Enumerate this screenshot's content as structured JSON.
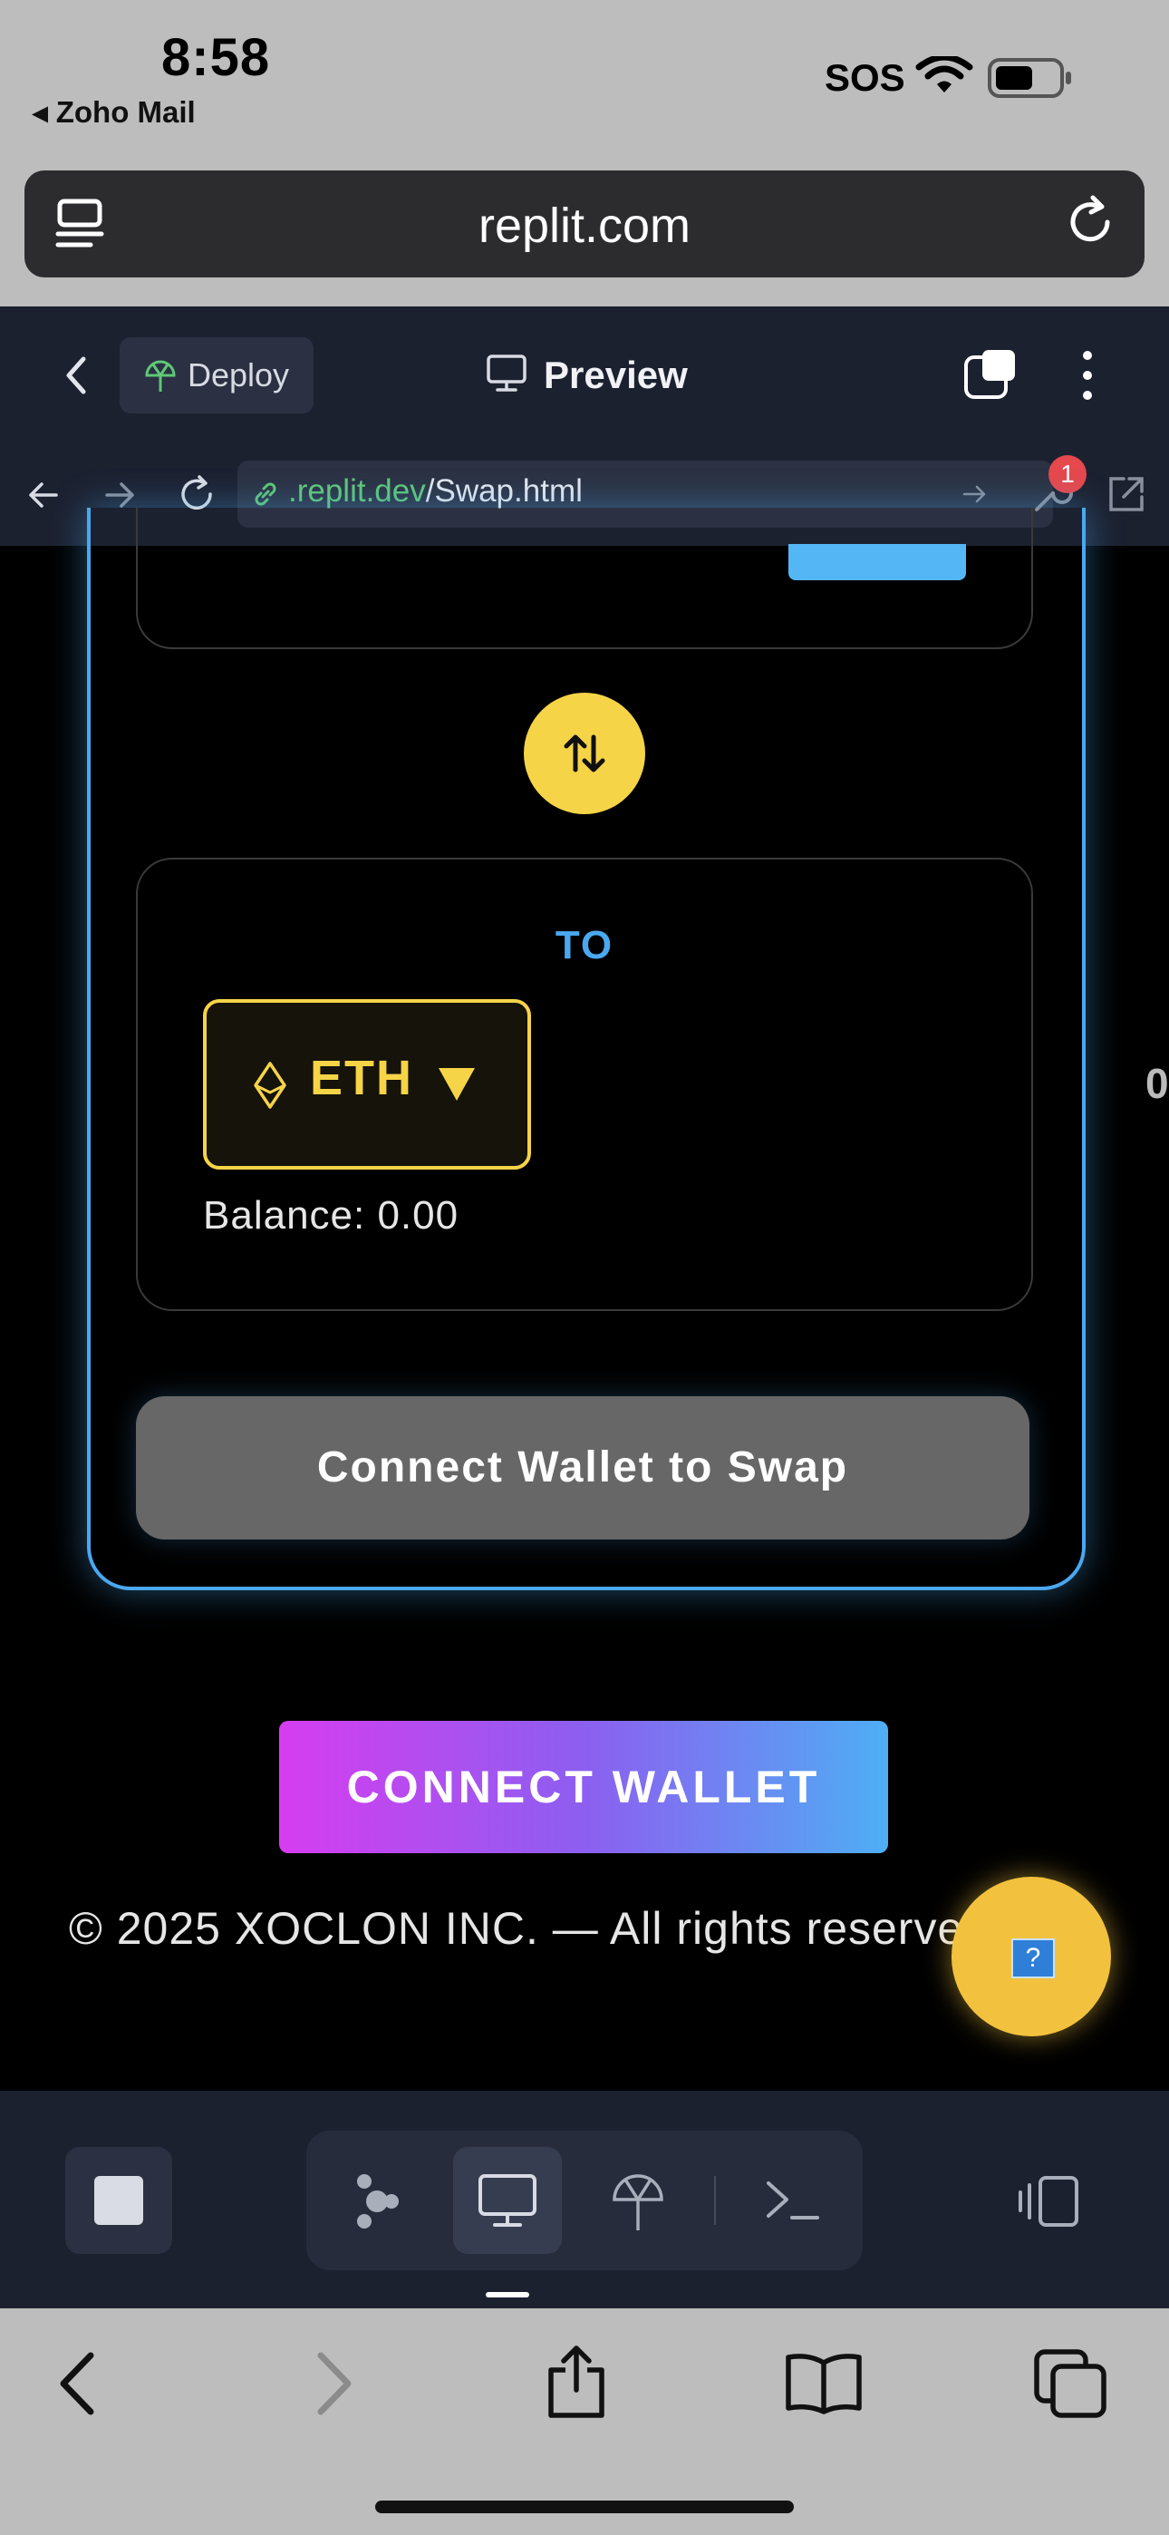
{
  "status_bar": {
    "time": "8:58",
    "back_app": "◂ Zoho Mail",
    "sos": "SOS"
  },
  "browser": {
    "url_display": "replit.com"
  },
  "replit_header": {
    "deploy_label": "Deploy",
    "preview_label": "Preview"
  },
  "address_bar": {
    "host": ".replit.dev",
    "path": "/Swap.html",
    "devtools_badge": "1"
  },
  "swap_card": {
    "to_label": "TO",
    "token": {
      "symbol": "ETH",
      "icon": "ethereum-icon"
    },
    "balance": "Balance: 0.00",
    "swap_direction_icon": "swap-arrows-icon",
    "connect_swap_button": "Connect Wallet to Swap"
  },
  "page": {
    "connect_wallet_button": "CONNECT WALLET",
    "footer": "© 2025 XOCLON INC. — All rights reserved.",
    "help_icon_glyph": "?",
    "side_char": "0"
  },
  "colors": {
    "accent_blue": "#4aa8f0",
    "accent_yellow": "#f6d447",
    "gradient_start": "#d63df0",
    "gradient_end": "#4eaef4"
  }
}
